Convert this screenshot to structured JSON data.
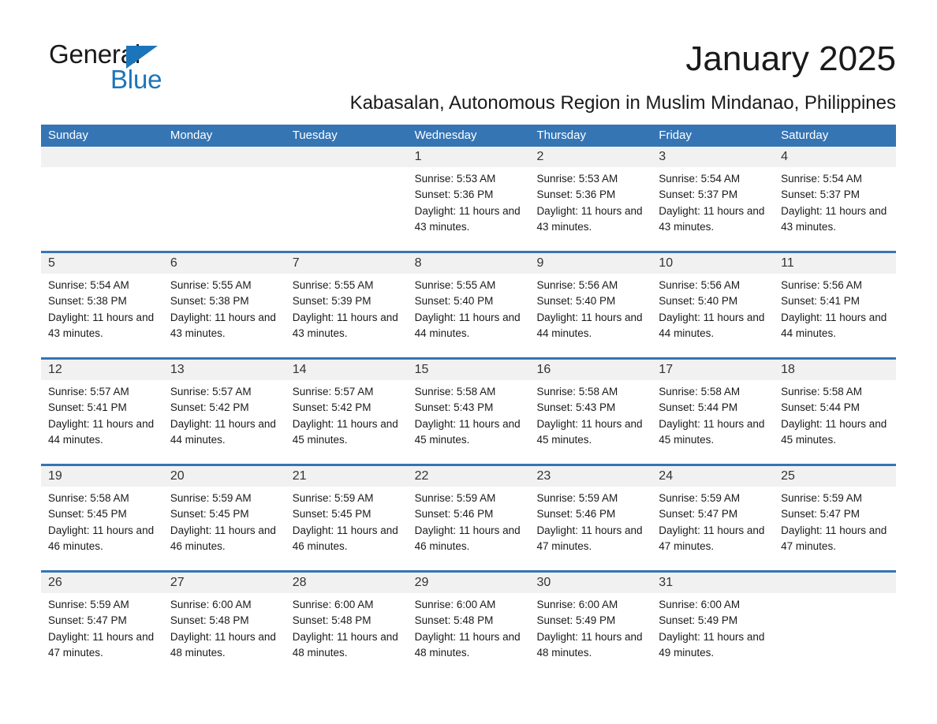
{
  "brand": {
    "word_general": "General",
    "word_blue": "Blue",
    "triangle_color": "#1b75bb"
  },
  "header": {
    "month_title": "January 2025",
    "subtitle": "Kabasalan, Autonomous Region in Muslim Mindanao, Philippines"
  },
  "theme": {
    "header_blue": "#3575b4",
    "day_band_gray": "#f1f1f1",
    "text": "#1a1a1a"
  },
  "weekdays": [
    "Sunday",
    "Monday",
    "Tuesday",
    "Wednesday",
    "Thursday",
    "Friday",
    "Saturday"
  ],
  "weeks": [
    [
      {
        "day": "",
        "empty": true
      },
      {
        "day": "",
        "empty": true
      },
      {
        "day": "",
        "empty": true
      },
      {
        "day": "1",
        "sunrise": "Sunrise: 5:53 AM",
        "sunset": "Sunset: 5:36 PM",
        "daylight": "Daylight: 11 hours and 43 minutes."
      },
      {
        "day": "2",
        "sunrise": "Sunrise: 5:53 AM",
        "sunset": "Sunset: 5:36 PM",
        "daylight": "Daylight: 11 hours and 43 minutes."
      },
      {
        "day": "3",
        "sunrise": "Sunrise: 5:54 AM",
        "sunset": "Sunset: 5:37 PM",
        "daylight": "Daylight: 11 hours and 43 minutes."
      },
      {
        "day": "4",
        "sunrise": "Sunrise: 5:54 AM",
        "sunset": "Sunset: 5:37 PM",
        "daylight": "Daylight: 11 hours and 43 minutes."
      }
    ],
    [
      {
        "day": "5",
        "sunrise": "Sunrise: 5:54 AM",
        "sunset": "Sunset: 5:38 PM",
        "daylight": "Daylight: 11 hours and 43 minutes."
      },
      {
        "day": "6",
        "sunrise": "Sunrise: 5:55 AM",
        "sunset": "Sunset: 5:38 PM",
        "daylight": "Daylight: 11 hours and 43 minutes."
      },
      {
        "day": "7",
        "sunrise": "Sunrise: 5:55 AM",
        "sunset": "Sunset: 5:39 PM",
        "daylight": "Daylight: 11 hours and 43 minutes."
      },
      {
        "day": "8",
        "sunrise": "Sunrise: 5:55 AM",
        "sunset": "Sunset: 5:40 PM",
        "daylight": "Daylight: 11 hours and 44 minutes."
      },
      {
        "day": "9",
        "sunrise": "Sunrise: 5:56 AM",
        "sunset": "Sunset: 5:40 PM",
        "daylight": "Daylight: 11 hours and 44 minutes."
      },
      {
        "day": "10",
        "sunrise": "Sunrise: 5:56 AM",
        "sunset": "Sunset: 5:40 PM",
        "daylight": "Daylight: 11 hours and 44 minutes."
      },
      {
        "day": "11",
        "sunrise": "Sunrise: 5:56 AM",
        "sunset": "Sunset: 5:41 PM",
        "daylight": "Daylight: 11 hours and 44 minutes."
      }
    ],
    [
      {
        "day": "12",
        "sunrise": "Sunrise: 5:57 AM",
        "sunset": "Sunset: 5:41 PM",
        "daylight": "Daylight: 11 hours and 44 minutes."
      },
      {
        "day": "13",
        "sunrise": "Sunrise: 5:57 AM",
        "sunset": "Sunset: 5:42 PM",
        "daylight": "Daylight: 11 hours and 44 minutes."
      },
      {
        "day": "14",
        "sunrise": "Sunrise: 5:57 AM",
        "sunset": "Sunset: 5:42 PM",
        "daylight": "Daylight: 11 hours and 45 minutes."
      },
      {
        "day": "15",
        "sunrise": "Sunrise: 5:58 AM",
        "sunset": "Sunset: 5:43 PM",
        "daylight": "Daylight: 11 hours and 45 minutes."
      },
      {
        "day": "16",
        "sunrise": "Sunrise: 5:58 AM",
        "sunset": "Sunset: 5:43 PM",
        "daylight": "Daylight: 11 hours and 45 minutes."
      },
      {
        "day": "17",
        "sunrise": "Sunrise: 5:58 AM",
        "sunset": "Sunset: 5:44 PM",
        "daylight": "Daylight: 11 hours and 45 minutes."
      },
      {
        "day": "18",
        "sunrise": "Sunrise: 5:58 AM",
        "sunset": "Sunset: 5:44 PM",
        "daylight": "Daylight: 11 hours and 45 minutes."
      }
    ],
    [
      {
        "day": "19",
        "sunrise": "Sunrise: 5:58 AM",
        "sunset": "Sunset: 5:45 PM",
        "daylight": "Daylight: 11 hours and 46 minutes."
      },
      {
        "day": "20",
        "sunrise": "Sunrise: 5:59 AM",
        "sunset": "Sunset: 5:45 PM",
        "daylight": "Daylight: 11 hours and 46 minutes."
      },
      {
        "day": "21",
        "sunrise": "Sunrise: 5:59 AM",
        "sunset": "Sunset: 5:45 PM",
        "daylight": "Daylight: 11 hours and 46 minutes."
      },
      {
        "day": "22",
        "sunrise": "Sunrise: 5:59 AM",
        "sunset": "Sunset: 5:46 PM",
        "daylight": "Daylight: 11 hours and 46 minutes."
      },
      {
        "day": "23",
        "sunrise": "Sunrise: 5:59 AM",
        "sunset": "Sunset: 5:46 PM",
        "daylight": "Daylight: 11 hours and 47 minutes."
      },
      {
        "day": "24",
        "sunrise": "Sunrise: 5:59 AM",
        "sunset": "Sunset: 5:47 PM",
        "daylight": "Daylight: 11 hours and 47 minutes."
      },
      {
        "day": "25",
        "sunrise": "Sunrise: 5:59 AM",
        "sunset": "Sunset: 5:47 PM",
        "daylight": "Daylight: 11 hours and 47 minutes."
      }
    ],
    [
      {
        "day": "26",
        "sunrise": "Sunrise: 5:59 AM",
        "sunset": "Sunset: 5:47 PM",
        "daylight": "Daylight: 11 hours and 47 minutes."
      },
      {
        "day": "27",
        "sunrise": "Sunrise: 6:00 AM",
        "sunset": "Sunset: 5:48 PM",
        "daylight": "Daylight: 11 hours and 48 minutes."
      },
      {
        "day": "28",
        "sunrise": "Sunrise: 6:00 AM",
        "sunset": "Sunset: 5:48 PM",
        "daylight": "Daylight: 11 hours and 48 minutes."
      },
      {
        "day": "29",
        "sunrise": "Sunrise: 6:00 AM",
        "sunset": "Sunset: 5:48 PM",
        "daylight": "Daylight: 11 hours and 48 minutes."
      },
      {
        "day": "30",
        "sunrise": "Sunrise: 6:00 AM",
        "sunset": "Sunset: 5:49 PM",
        "daylight": "Daylight: 11 hours and 48 minutes."
      },
      {
        "day": "31",
        "sunrise": "Sunrise: 6:00 AM",
        "sunset": "Sunset: 5:49 PM",
        "daylight": "Daylight: 11 hours and 49 minutes."
      },
      {
        "day": "",
        "empty": true
      }
    ]
  ]
}
